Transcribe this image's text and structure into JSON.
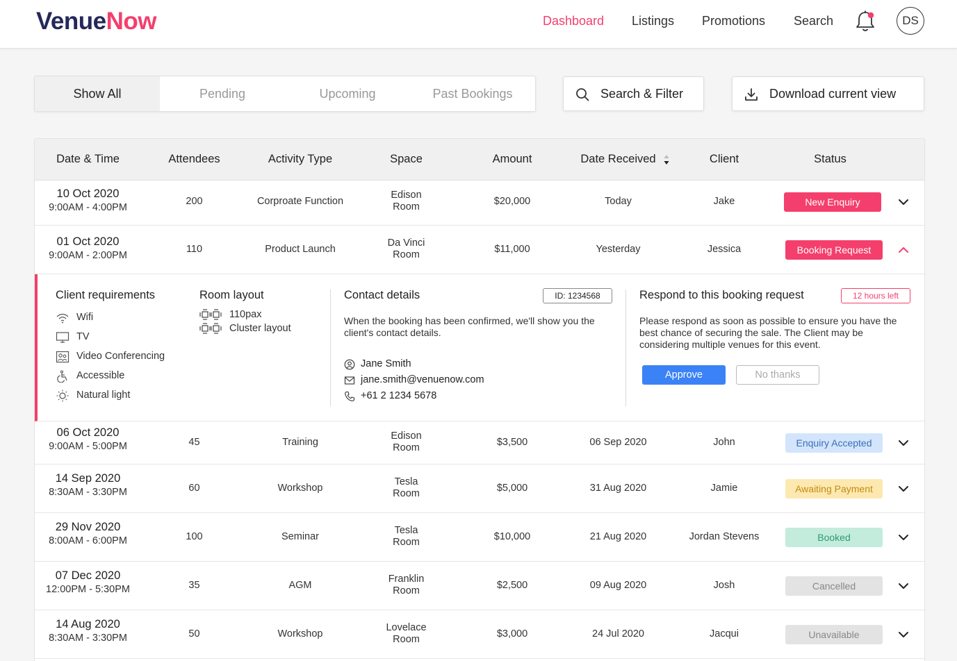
{
  "header": {
    "logo_part1": "Venue",
    "logo_part2": "Now",
    "nav": [
      "Dashboard",
      "Listings",
      "Promotions",
      "Search"
    ],
    "active_nav": "Dashboard",
    "avatar_initials": "DS",
    "notification_dot": true
  },
  "toolbar": {
    "tabs": [
      "Show All",
      "Pending",
      "Upcoming",
      "Past Bookings"
    ],
    "active_tab": "Show All",
    "search_filter_label": "Search & Filter",
    "download_label": "Download current view"
  },
  "table": {
    "columns": [
      "Date & Time",
      "Attendees",
      "Activity Type",
      "Space",
      "Amount",
      "Date Received",
      "Client",
      "Status"
    ],
    "rows": [
      {
        "date": "10 Oct 2020",
        "time": "9:00AM - 4:00PM",
        "attendees": "200",
        "activity": "Corproate Function",
        "space1": "Edison",
        "space2": "Room",
        "amount": "$20,000",
        "received": "Today",
        "client": "Jake",
        "status": "New Enquiry"
      },
      {
        "date": "01 Oct 2020",
        "time": "9:00AM - 2:00PM",
        "attendees": "110",
        "activity": "Product Launch",
        "space1": "Da Vinci",
        "space2": "Room",
        "amount": "$11,000",
        "received": "Yesterday",
        "client": "Jessica",
        "status": "Booking Request"
      },
      {
        "date": "06 Oct 2020",
        "time": "9:00AM - 5:00PM",
        "attendees": "45",
        "activity": "Training",
        "space1": "Edison",
        "space2": "Room",
        "amount": "$3,500",
        "received": "06 Sep 2020",
        "client": "John",
        "status": "Enquiry Accepted"
      },
      {
        "date": "14 Sep 2020",
        "time": "8:30AM - 3:30PM",
        "attendees": "60",
        "activity": "Workshop",
        "space1": "Tesla",
        "space2": "Room",
        "amount": "$5,000",
        "received": "31 Aug 2020",
        "client": "Jamie",
        "status": "Awaiting Payment"
      },
      {
        "date": "29 Nov 2020",
        "time": "8:00AM - 6:00PM",
        "attendees": "100",
        "activity": "Seminar",
        "space1": "Tesla",
        "space2": "Room",
        "amount": "$10,000",
        "received": "21 Aug 2020",
        "client": "Jordan Stevens",
        "status": "Booked"
      },
      {
        "date": "07 Dec 2020",
        "time": "12:00PM - 5:30PM",
        "attendees": "35",
        "activity": "AGM",
        "space1": "Franklin",
        "space2": "Room",
        "amount": "$2,500",
        "received": "09 Aug 2020",
        "client": "Josh",
        "status": "Cancelled"
      },
      {
        "date": "14 Aug 2020",
        "time": "8:30AM - 3:30PM",
        "attendees": "50",
        "activity": "Workshop",
        "space1": "Lovelace",
        "space2": "Room",
        "amount": "$3,000",
        "received": "24 Jul 2020",
        "client": "Jacqui",
        "status": "Unavailable"
      }
    ]
  },
  "status_colors": {
    "New Enquiry": {
      "bg": "#f43f6c",
      "fg": "#ffffff"
    },
    "Booking Request": {
      "bg": "#f43f6c",
      "fg": "#ffffff"
    },
    "Enquiry Accepted": {
      "bg": "#d3e5fb",
      "fg": "#3b6fb8"
    },
    "Awaiting Payment": {
      "bg": "#fde9b0",
      "fg": "#c28b12"
    },
    "Booked": {
      "bg": "#c3ecdd",
      "fg": "#2f9a74"
    },
    "Cancelled": {
      "bg": "#e3e3e3",
      "fg": "#888888"
    },
    "Unavailable": {
      "bg": "#e3e3e3",
      "fg": "#888888"
    }
  },
  "expanded": {
    "requirements_title": "Client requirements",
    "requirements": [
      {
        "icon": "wifi-icon",
        "label": "Wifi"
      },
      {
        "icon": "tv-icon",
        "label": "TV"
      },
      {
        "icon": "video-conferencing-icon",
        "label": "Video Conferencing"
      },
      {
        "icon": "accessible-icon",
        "label": "Accessible"
      },
      {
        "icon": "sun-icon",
        "label": "Natural light"
      }
    ],
    "layout_title": "Room layout",
    "layout_pax": "110pax",
    "layout_type": "Cluster layout",
    "contact_title": "Contact details",
    "booking_id": "ID: 1234568",
    "contact_note": "When the booking has been confirmed, we'll show you the client's contact details.",
    "contact_name": "Jane Smith",
    "contact_email": "jane.smith@venuenow.com",
    "contact_phone": "+61 2 1234 5678",
    "respond_title": "Respond to this booking request",
    "time_left": "12 hours left",
    "respond_note": "Please respond as soon as possible to ensure you have the best chance of securing the sale. The Client may be considering multiple venues for this event.",
    "approve_label": "Approve",
    "decline_label": "No thanks"
  },
  "colors": {
    "accent": "#f43f6c",
    "brand_dark": "#25285a",
    "primary_blue": "#3b82f6"
  }
}
